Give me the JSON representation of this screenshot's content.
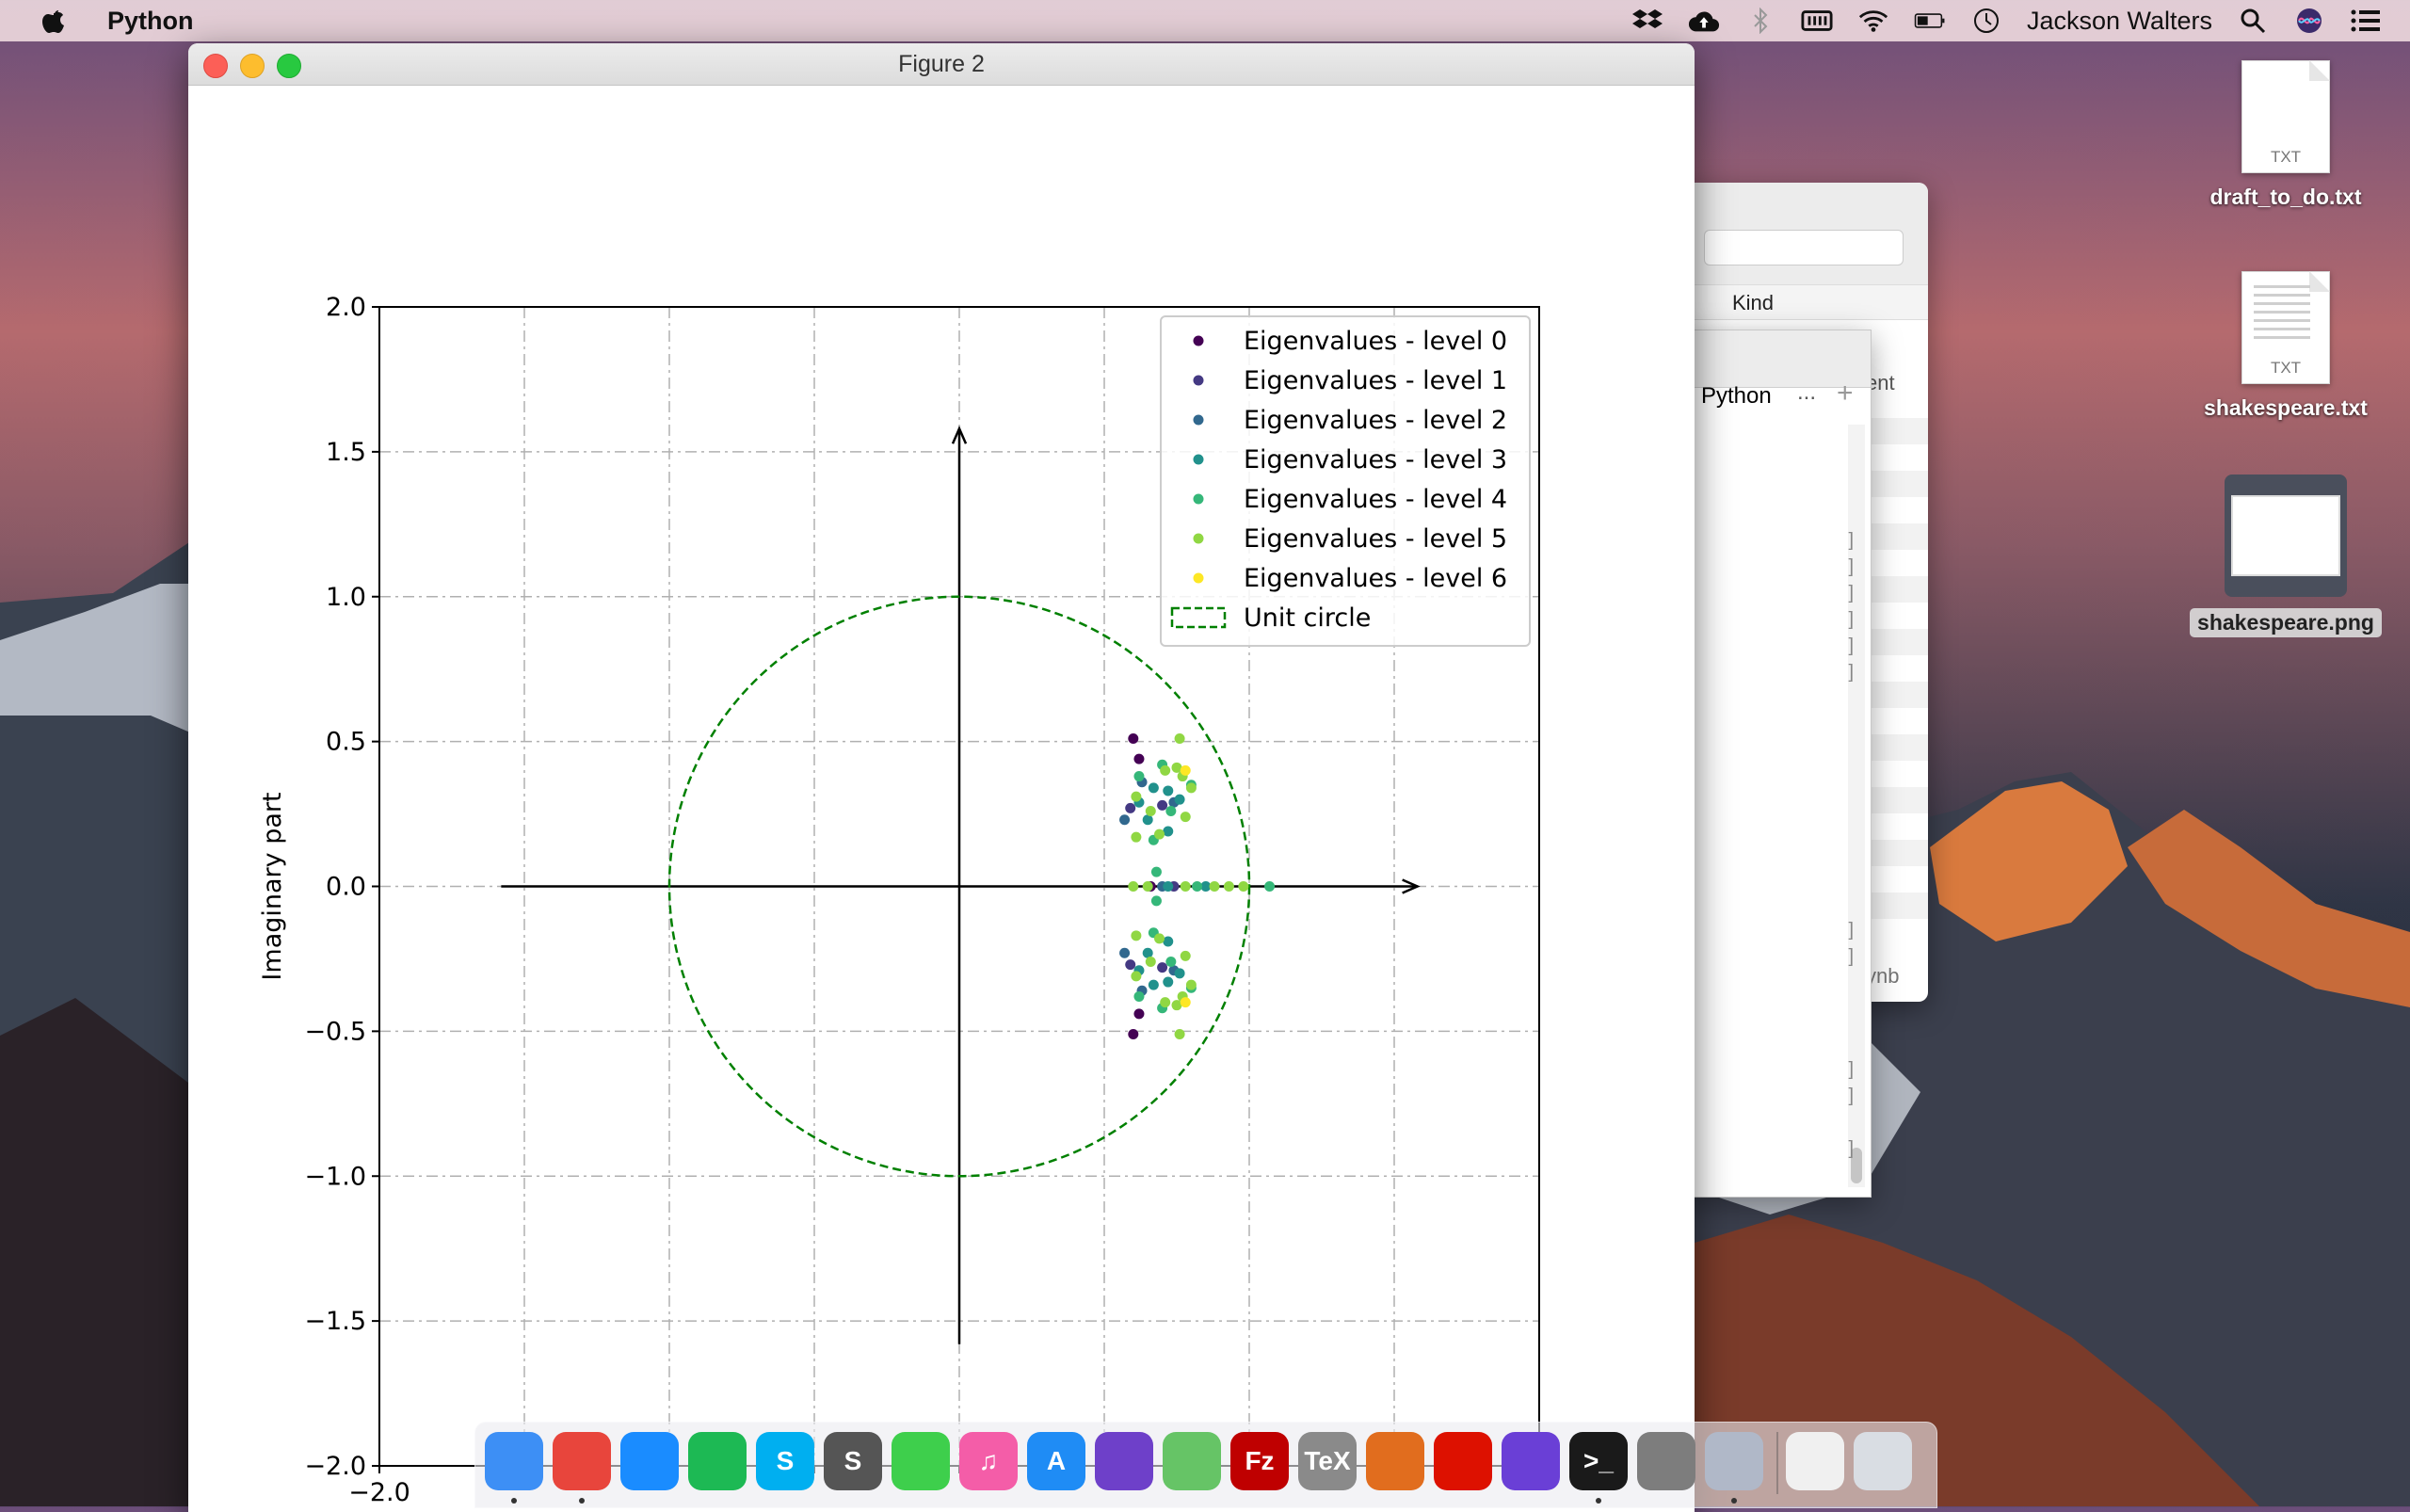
{
  "menubar": {
    "app_name": "Python",
    "user": "Jackson Walters",
    "icons": [
      "apple-icon",
      "dropbox-icon",
      "cloud-upload-icon",
      "bluetooth-icon",
      "memory-icon",
      "wifi-icon",
      "battery-icon",
      "clock-icon",
      "search-icon",
      "siri-icon",
      "list-icon"
    ]
  },
  "window": {
    "title": "Figure 2"
  },
  "finder": {
    "column_kind": "Kind",
    "partial_ent": "ent",
    "partial_ynb": "ynb"
  },
  "jupyter": {
    "tab_label": "Python",
    "tab_more": "...",
    "tab_add": "+",
    "bracket": "]"
  },
  "desktop": {
    "files": [
      {
        "name": "draft_to_do.txt",
        "ext": "TXT"
      },
      {
        "name": "shakespeare.txt",
        "ext": "TXT"
      },
      {
        "name": "shakespeare.png",
        "ext": ""
      }
    ]
  },
  "chart_data": {
    "type": "scatter",
    "title": "",
    "xlabel": "",
    "ylabel": "Imaginary part",
    "xlim": [
      -2.0,
      2.0
    ],
    "ylim": [
      -2.0,
      2.0
    ],
    "yticks": [
      "2.0",
      "1.5",
      "1.0",
      "0.5",
      "0.0",
      "−0.5",
      "−1.0",
      "−1.5",
      "−2.0"
    ],
    "xticks_visible": [
      "−2.0"
    ],
    "grid": true,
    "legend_position": "upper right",
    "axes_arrows": {
      "x_from": -1.58,
      "x_to": 1.58,
      "y_from": -1.58,
      "y_to": 1.58
    },
    "unit_circle": {
      "name": "Unit circle",
      "radius": 1.0,
      "color": "#008000",
      "style": "dashed"
    },
    "series": [
      {
        "name": "Eigenvalues - level 0",
        "color": "#440154",
        "points": [
          [
            0.6,
            0.51
          ],
          [
            0.62,
            0.44
          ],
          [
            0.6,
            -0.51
          ],
          [
            0.62,
            -0.44
          ],
          [
            0.66,
            0.0
          ]
        ]
      },
      {
        "name": "Eigenvalues - level 1",
        "color": "#443983",
        "points": [
          [
            0.59,
            0.27
          ],
          [
            0.7,
            0.28
          ],
          [
            0.59,
            -0.27
          ],
          [
            0.7,
            -0.28
          ],
          [
            0.74,
            0.0
          ]
        ]
      },
      {
        "name": "Eigenvalues - level 2",
        "color": "#31688e",
        "points": [
          [
            0.57,
            0.23
          ],
          [
            0.63,
            0.36
          ],
          [
            0.74,
            0.29
          ],
          [
            0.57,
            -0.23
          ],
          [
            0.63,
            -0.36
          ],
          [
            0.74,
            -0.29
          ],
          [
            0.7,
            0.0
          ]
        ]
      },
      {
        "name": "Eigenvalues - level 3",
        "color": "#21918c",
        "points": [
          [
            0.62,
            0.29
          ],
          [
            0.67,
            0.34
          ],
          [
            0.72,
            0.33
          ],
          [
            0.76,
            0.3
          ],
          [
            0.65,
            0.23
          ],
          [
            0.72,
            0.19
          ],
          [
            0.62,
            -0.29
          ],
          [
            0.67,
            -0.34
          ],
          [
            0.72,
            -0.33
          ],
          [
            0.76,
            -0.3
          ],
          [
            0.65,
            -0.23
          ],
          [
            0.72,
            -0.19
          ],
          [
            0.72,
            0.0
          ],
          [
            0.85,
            0.0
          ]
        ]
      },
      {
        "name": "Eigenvalues - level 4",
        "color": "#35b779",
        "points": [
          [
            0.62,
            0.38
          ],
          [
            0.7,
            0.42
          ],
          [
            0.8,
            0.35
          ],
          [
            0.67,
            0.16
          ],
          [
            0.73,
            0.26
          ],
          [
            0.68,
            0.05
          ],
          [
            0.62,
            -0.38
          ],
          [
            0.7,
            -0.42
          ],
          [
            0.8,
            -0.35
          ],
          [
            0.67,
            -0.16
          ],
          [
            0.73,
            -0.26
          ],
          [
            0.68,
            -0.05
          ],
          [
            0.82,
            0.0
          ],
          [
            1.07,
            0.0
          ]
        ]
      },
      {
        "name": "Eigenvalues - level 5",
        "color": "#90d743",
        "points": [
          [
            0.61,
            0.31
          ],
          [
            0.66,
            0.26
          ],
          [
            0.71,
            0.4
          ],
          [
            0.75,
            0.41
          ],
          [
            0.77,
            0.38
          ],
          [
            0.76,
            0.51
          ],
          [
            0.78,
            0.24
          ],
          [
            0.8,
            0.34
          ],
          [
            0.61,
            0.17
          ],
          [
            0.69,
            0.18
          ],
          [
            0.61,
            -0.31
          ],
          [
            0.66,
            -0.26
          ],
          [
            0.71,
            -0.4
          ],
          [
            0.75,
            -0.41
          ],
          [
            0.77,
            -0.38
          ],
          [
            0.76,
            -0.51
          ],
          [
            0.78,
            -0.24
          ],
          [
            0.8,
            -0.34
          ],
          [
            0.61,
            -0.17
          ],
          [
            0.69,
            -0.18
          ],
          [
            0.6,
            0.0
          ],
          [
            0.65,
            0.0
          ],
          [
            0.78,
            0.0
          ],
          [
            0.88,
            0.0
          ],
          [
            0.93,
            0.0
          ],
          [
            0.98,
            0.0
          ]
        ]
      },
      {
        "name": "Eigenvalues - level 6",
        "color": "#fde725",
        "points": [
          [
            0.78,
            0.4
          ],
          [
            0.78,
            -0.4
          ]
        ]
      }
    ]
  },
  "dock": {
    "apps": [
      {
        "name": "finder-icon",
        "label": "",
        "color": "#3d8ff5",
        "running": true
      },
      {
        "name": "chrome-icon",
        "label": "",
        "color": "#e8453c",
        "running": true
      },
      {
        "name": "safari-icon",
        "label": "",
        "color": "#1a8cff",
        "running": false
      },
      {
        "name": "spotify-icon",
        "label": "",
        "color": "#1db954",
        "running": false
      },
      {
        "name": "skype-icon",
        "label": "S",
        "color": "#00aff0",
        "running": false
      },
      {
        "name": "scrivener-icon",
        "label": "S",
        "color": "#555555",
        "running": false
      },
      {
        "name": "facetime-icon",
        "label": "",
        "color": "#3ecf4c",
        "running": false
      },
      {
        "name": "itunes-icon",
        "label": "♫",
        "color": "#f45da8",
        "running": false
      },
      {
        "name": "app-store-icon",
        "label": "A",
        "color": "#1f8cf5",
        "running": false
      },
      {
        "name": "github-icon",
        "label": "",
        "color": "#6e40c9",
        "running": false
      },
      {
        "name": "atom-icon",
        "label": "",
        "color": "#66c466",
        "running": false
      },
      {
        "name": "filezilla-icon",
        "label": "Fz",
        "color": "#bf0000",
        "running": false
      },
      {
        "name": "tex-icon",
        "label": "TeX",
        "color": "#8a8a8a",
        "running": false
      },
      {
        "name": "matlab-icon",
        "label": "",
        "color": "#e16d1e",
        "running": false
      },
      {
        "name": "mathematica-icon",
        "label": "",
        "color": "#dd1100",
        "running": false
      },
      {
        "name": "siri-icon",
        "label": "",
        "color": "#6a3fd6",
        "running": false
      },
      {
        "name": "terminal-icon",
        "label": ">_",
        "color": "#1a1a1a",
        "running": true
      },
      {
        "name": "system-preferences-icon",
        "label": "",
        "color": "#7d7d7d",
        "running": false
      },
      {
        "name": "rocket-icon",
        "label": "",
        "color": "#b0b8c8",
        "running": true
      },
      {
        "name": "preview-icon",
        "label": "",
        "color": "#f0f0f0",
        "running": false
      },
      {
        "name": "trash-icon",
        "label": "",
        "color": "#d9dde3",
        "running": false
      }
    ]
  }
}
